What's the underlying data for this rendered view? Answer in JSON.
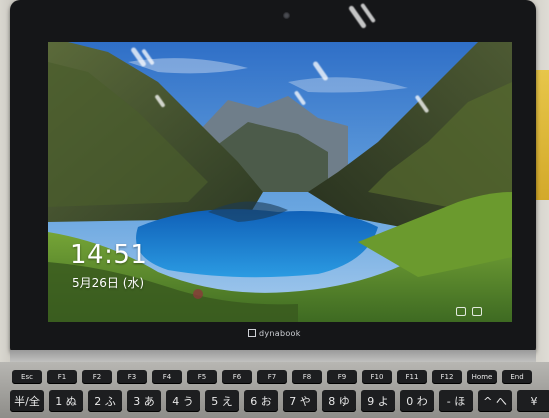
{
  "lock_screen": {
    "time": "14:51",
    "date": "5月26日 (水)"
  },
  "laptop": {
    "brand": "dynabook"
  },
  "keyboard": {
    "function_row": [
      "Esc",
      "F1",
      "F2",
      "F3",
      "F4",
      "F5",
      "F6",
      "F7",
      "F8",
      "F9",
      "F10",
      "F11",
      "F12",
      "Home",
      "End"
    ],
    "number_row": [
      "半/全",
      "1 ぬ",
      "2 ふ",
      "3 あ",
      "4 う",
      "5 え",
      "6 お",
      "7 や",
      "8 ゆ",
      "9 よ",
      "0 わ",
      "- ほ",
      "^ へ",
      "¥"
    ]
  }
}
